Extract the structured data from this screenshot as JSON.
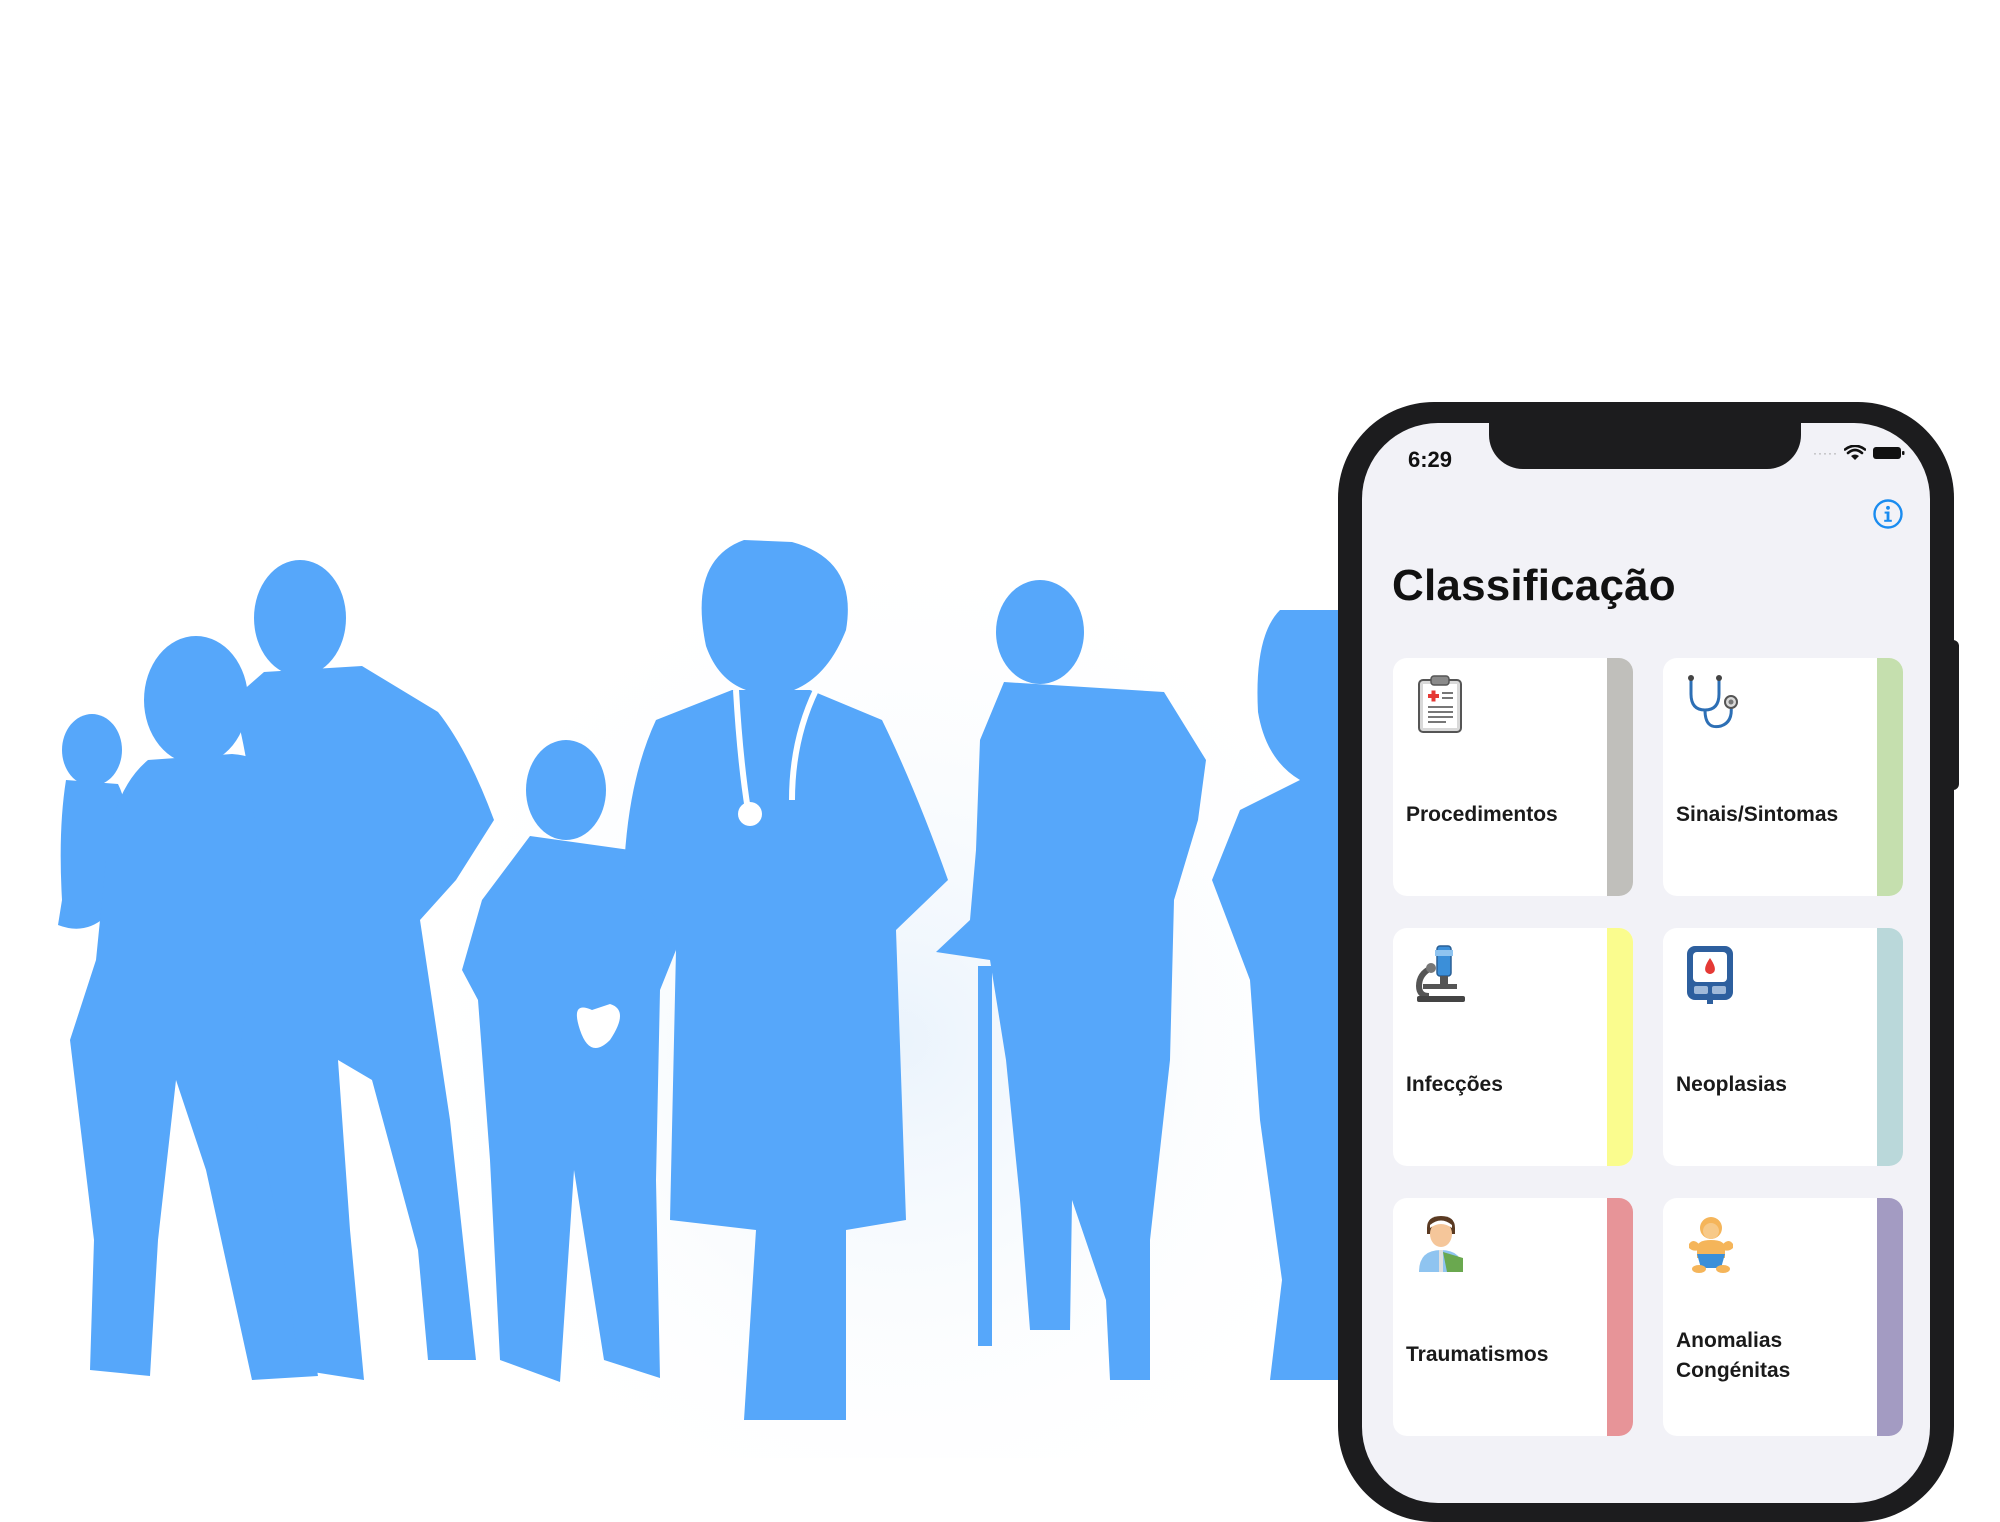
{
  "status_bar": {
    "time": "6:29"
  },
  "nav": {
    "info_icon": "info-circle-icon"
  },
  "title": "Classificação",
  "categories": [
    {
      "label": "Procedimentos",
      "icon": "clipboard-icon",
      "stripe_color": "#c0bfbb"
    },
    {
      "label": "Sinais/Sintomas",
      "icon": "stethoscope-icon",
      "stripe_color": "#c5dfae"
    },
    {
      "label": "Infecções",
      "icon": "microscope-icon",
      "stripe_color": "#fafc8e"
    },
    {
      "label": "Neoplasias",
      "icon": "blood-glucose-meter-icon",
      "stripe_color": "#bad8da"
    },
    {
      "label": "Traumatismos",
      "icon": "injured-person-icon",
      "stripe_color": "#e79498"
    },
    {
      "label": "Anomalias Congénitas",
      "icon": "baby-icon",
      "stripe_color": "#a39bc2"
    }
  ],
  "colors": {
    "accent": "#1a8cf0",
    "silhouette": "#56a7fa",
    "screen_background": "#f2f2f7",
    "phone_frame": "#1c1c1e"
  }
}
